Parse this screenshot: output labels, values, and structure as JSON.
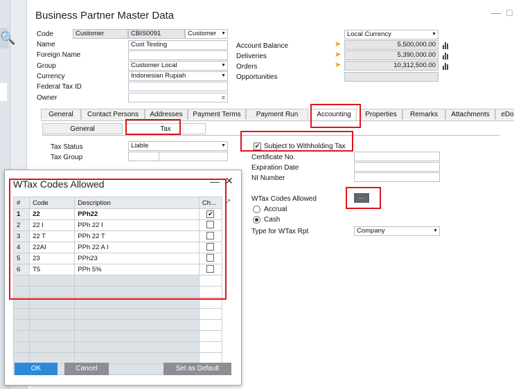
{
  "window": {
    "title": "Business Partner Master Data"
  },
  "header": {
    "code_label": "Code",
    "code_type": "Customer",
    "code_value": "CBIS0091",
    "code_group": "Customer",
    "name_label": "Name",
    "name_value": "Cust Testing",
    "foreign_name_label": "Foreign Name",
    "foreign_name_value": "",
    "group_label": "Group",
    "group_value": "Customer Local",
    "currency_label": "Currency",
    "currency_value": "Indonesian Rupiah",
    "federal_tax_label": "Federal Tax ID",
    "federal_tax_value": "",
    "owner_label": "Owner",
    "owner_value": ""
  },
  "balances": {
    "currency_select": "Local Currency",
    "account_balance_label": "Account Balance",
    "account_balance_value": "5,500,000.00",
    "deliveries_label": "Deliveries",
    "deliveries_value": "5,390,000.00",
    "orders_label": "Orders",
    "orders_value": "10,312,500.00",
    "opportunities_label": "Opportunities",
    "opportunities_value": ""
  },
  "tabs": [
    "General",
    "Contact Persons",
    "Addresses",
    "Payment Terms",
    "Payment Run",
    "Accounting",
    "Properties",
    "Remarks",
    "Attachments",
    "eDoc"
  ],
  "subtabs": [
    "General",
    "Tax"
  ],
  "tax": {
    "status_label": "Tax Status",
    "status_value": "Liable",
    "group_label": "Tax Group",
    "group_value": "",
    "subject_withholding_label": "Subject to Withholding Tax",
    "certificate_label": "Certificate No.",
    "expiration_label": "Expiration Date",
    "ni_label": "NI Number",
    "wtax_allowed_label": "WTax Codes Allowed",
    "wtax_button": "...",
    "accrual_label": "Accrual",
    "cash_label": "Cash",
    "type_rpt_label": "Type for WTax Rpt",
    "type_rpt_value": "Company"
  },
  "dialog": {
    "title": "WTax Codes Allowed",
    "columns": [
      "#",
      "Code",
      "Description",
      "Ch..."
    ],
    "rows": [
      {
        "n": "1",
        "code": "22",
        "desc": "PPh22",
        "checked": true
      },
      {
        "n": "2",
        "code": "22 I",
        "desc": "PPh 22 I",
        "checked": false
      },
      {
        "n": "3",
        "code": "22 T",
        "desc": "PPh 22 T",
        "checked": false
      },
      {
        "n": "4",
        "code": "22AI",
        "desc": "PPh 22 A I",
        "checked": false
      },
      {
        "n": "5",
        "code": "23",
        "desc": "PPh23",
        "checked": false
      },
      {
        "n": "6",
        "code": "T5",
        "desc": "PPh  5%",
        "checked": false
      }
    ],
    "ok_label": "OK",
    "cancel_label": "Cancel",
    "default_label": "Set as Default"
  },
  "colors": {
    "highlight": "#e0121a",
    "ok_button": "#2b8ad8",
    "gray_button": "#8b8f94",
    "arrow": "#e8a400"
  }
}
